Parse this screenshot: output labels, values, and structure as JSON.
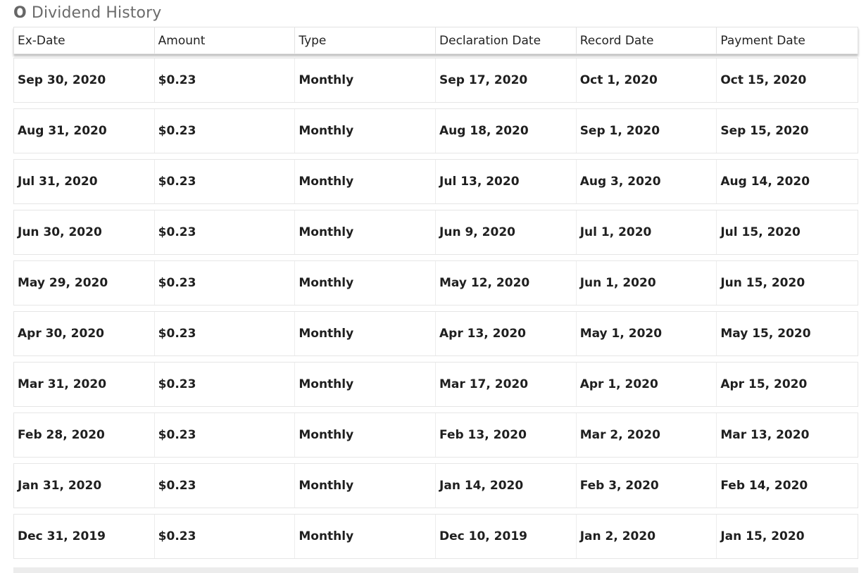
{
  "section": {
    "ticker": "O",
    "title": "Dividend History"
  },
  "table": {
    "headers": [
      "Ex-Date",
      "Amount",
      "Type",
      "Declaration Date",
      "Record Date",
      "Payment Date"
    ],
    "rows": [
      [
        "Sep 30, 2020",
        "$0.23",
        "Monthly",
        "Sep 17, 2020",
        "Oct 1, 2020",
        "Oct 15, 2020"
      ],
      [
        "Aug 31, 2020",
        "$0.23",
        "Monthly",
        "Aug 18, 2020",
        "Sep 1, 2020",
        "Sep 15, 2020"
      ],
      [
        "Jul 31, 2020",
        "$0.23",
        "Monthly",
        "Jul 13, 2020",
        "Aug 3, 2020",
        "Aug 14, 2020"
      ],
      [
        "Jun 30, 2020",
        "$0.23",
        "Monthly",
        "Jun 9, 2020",
        "Jul 1, 2020",
        "Jul 15, 2020"
      ],
      [
        "May 29, 2020",
        "$0.23",
        "Monthly",
        "May 12, 2020",
        "Jun 1, 2020",
        "Jun 15, 2020"
      ],
      [
        "Apr 30, 2020",
        "$0.23",
        "Monthly",
        "Apr 13, 2020",
        "May 1, 2020",
        "May 15, 2020"
      ],
      [
        "Mar 31, 2020",
        "$0.23",
        "Monthly",
        "Mar 17, 2020",
        "Apr 1, 2020",
        "Apr 15, 2020"
      ],
      [
        "Feb 28, 2020",
        "$0.23",
        "Monthly",
        "Feb 13, 2020",
        "Mar 2, 2020",
        "Mar 13, 2020"
      ],
      [
        "Jan 31, 2020",
        "$0.23",
        "Monthly",
        "Jan 14, 2020",
        "Feb 3, 2020",
        "Feb 14, 2020"
      ],
      [
        "Dec 31, 2019",
        "$0.23",
        "Monthly",
        "Dec 10, 2019",
        "Jan 2, 2020",
        "Jan 15, 2020"
      ]
    ]
  }
}
